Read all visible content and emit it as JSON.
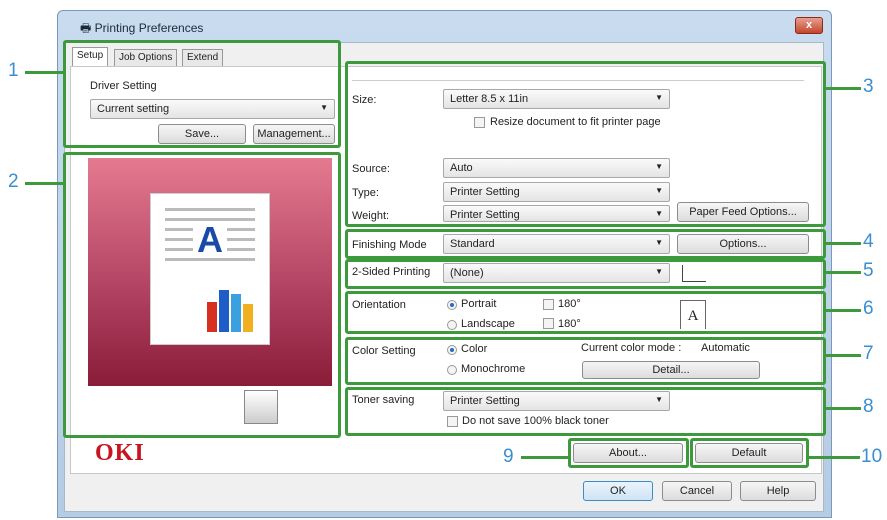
{
  "window": {
    "title": "Printing Preferences",
    "close": "x"
  },
  "tabs": [
    "Setup",
    "Job Options",
    "Extend"
  ],
  "driver": {
    "label": "Driver Setting",
    "value": "Current setting",
    "save": "Save...",
    "management": "Management..."
  },
  "paper": {
    "size_label": "Size:",
    "size_value": "Letter 8.5 x 11in",
    "resize": "Resize document to fit printer page",
    "source_label": "Source:",
    "source_value": "Auto",
    "type_label": "Type:",
    "type_value": "Printer Setting",
    "weight_label": "Weight:",
    "weight_value": "Printer Setting",
    "feed_options": "Paper Feed Options..."
  },
  "finishing": {
    "label": "Finishing Mode",
    "value": "Standard",
    "options": "Options..."
  },
  "duplex": {
    "label": "2-Sided Printing",
    "value": "(None)"
  },
  "orientation": {
    "label": "Orientation",
    "portrait": "Portrait",
    "landscape": "Landscape",
    "rotate1": "180°",
    "rotate2": "180°",
    "page_glyph": "A"
  },
  "color": {
    "label": "Color Setting",
    "color": "Color",
    "mono": "Monochrome",
    "mode_label": "Current color mode :",
    "mode_value": "Automatic",
    "detail": "Detail..."
  },
  "toner": {
    "label": "Toner saving",
    "value": "Printer Setting",
    "no_save": "Do not save 100% black toner"
  },
  "preview": {
    "glyph": "A"
  },
  "brand": "OKI",
  "buttons": {
    "about": "About...",
    "default": "Default",
    "ok": "OK",
    "cancel": "Cancel",
    "help": "Help"
  },
  "callouts": [
    "1",
    "2",
    "3",
    "4",
    "5",
    "6",
    "7",
    "8",
    "9",
    "10"
  ],
  "colors": {
    "callout": "#3a8ed2",
    "highlight": "#3c9a3c",
    "brand": "#c8141e"
  }
}
